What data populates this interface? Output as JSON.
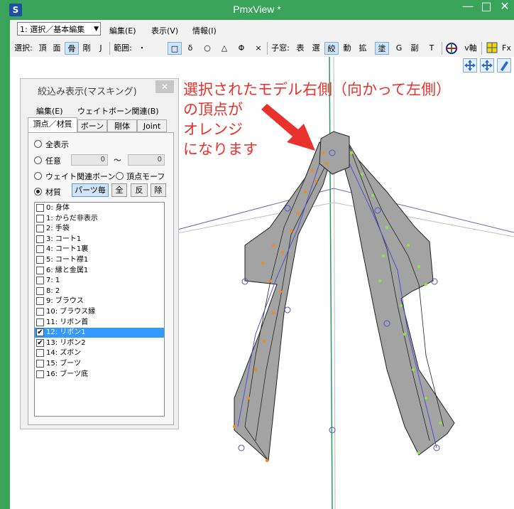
{
  "window": {
    "title": "PmxView *",
    "app_icon": "pmx-app-icon",
    "minimize": "—",
    "maximize": "□",
    "close": "✕"
  },
  "menubar": {
    "mode_select": "1: 選択／基本編集",
    "items": [
      "編集(E)",
      "表示(V)",
      "情報(I)"
    ]
  },
  "toolbar": {
    "select_label": "選択:",
    "select_items": [
      "頂",
      "面",
      "骨",
      "剛",
      "J"
    ],
    "range_label": "範囲:",
    "range_items": [
      "・",
      "□",
      "δ",
      "○",
      "△",
      "Φ",
      "×"
    ],
    "child_label": "子窓:",
    "child_items": [
      "表",
      "選",
      "絞",
      "動",
      "拡",
      "塗",
      "G",
      "副",
      "T"
    ],
    "extra_items": [
      "v軸",
      "Fx"
    ]
  },
  "annotation": {
    "lines": [
      "選択されたモデル右側（向かって左側）",
      "の頂点が",
      "オレンジ",
      "になります"
    ]
  },
  "panel": {
    "title": "絞込み表示(マスキング)",
    "close": "✕",
    "menu": [
      "編集(E)",
      "ウェイトボーン関連(B)"
    ],
    "tabs": [
      "頂点／材質",
      "ボーン",
      "剛体",
      "Joint"
    ],
    "show_all": "全表示",
    "arbitrary": "任意",
    "range_from": "0",
    "range_sep": "〜",
    "range_to": "0",
    "weight_bone": "ウェイト関連ボーン",
    "vertex_morph": "頂点モーフ",
    "material": "材質",
    "buttons": [
      "パーツ毎",
      "全",
      "反",
      "除"
    ],
    "materials": [
      {
        "label": "0: 身体",
        "checked": false,
        "selected": false
      },
      {
        "label": "1: からだ非表示",
        "checked": false,
        "selected": false
      },
      {
        "label": "2: 手袋",
        "checked": false,
        "selected": false
      },
      {
        "label": "3: コート1",
        "checked": false,
        "selected": false
      },
      {
        "label": "4: コート1裏",
        "checked": false,
        "selected": false
      },
      {
        "label": "5: コート襟1",
        "checked": false,
        "selected": false
      },
      {
        "label": "6: 縁と金属1",
        "checked": false,
        "selected": false
      },
      {
        "label": "7: 1",
        "checked": false,
        "selected": false
      },
      {
        "label": "8: 2",
        "checked": false,
        "selected": false
      },
      {
        "label": "9: ブラウス",
        "checked": false,
        "selected": false
      },
      {
        "label": "10: ブラウス縁",
        "checked": false,
        "selected": false
      },
      {
        "label": "11: リボン首",
        "checked": false,
        "selected": false
      },
      {
        "label": "12: リボン1",
        "checked": true,
        "selected": true
      },
      {
        "label": "13: リボン2",
        "checked": true,
        "selected": false
      },
      {
        "label": "14: ズボン",
        "checked": false,
        "selected": false
      },
      {
        "label": "15: ブーツ",
        "checked": false,
        "selected": false
      },
      {
        "label": "16: ブーツ底",
        "checked": false,
        "selected": false
      }
    ]
  },
  "colors": {
    "titlebar": "#3aa35a",
    "annotation": "#e8322b",
    "mesh_fill": "#a3a3a3",
    "selected_vertex": "#f08a24",
    "unselected_vertex": "#8ee04a",
    "bone_line": "#5050d0"
  }
}
